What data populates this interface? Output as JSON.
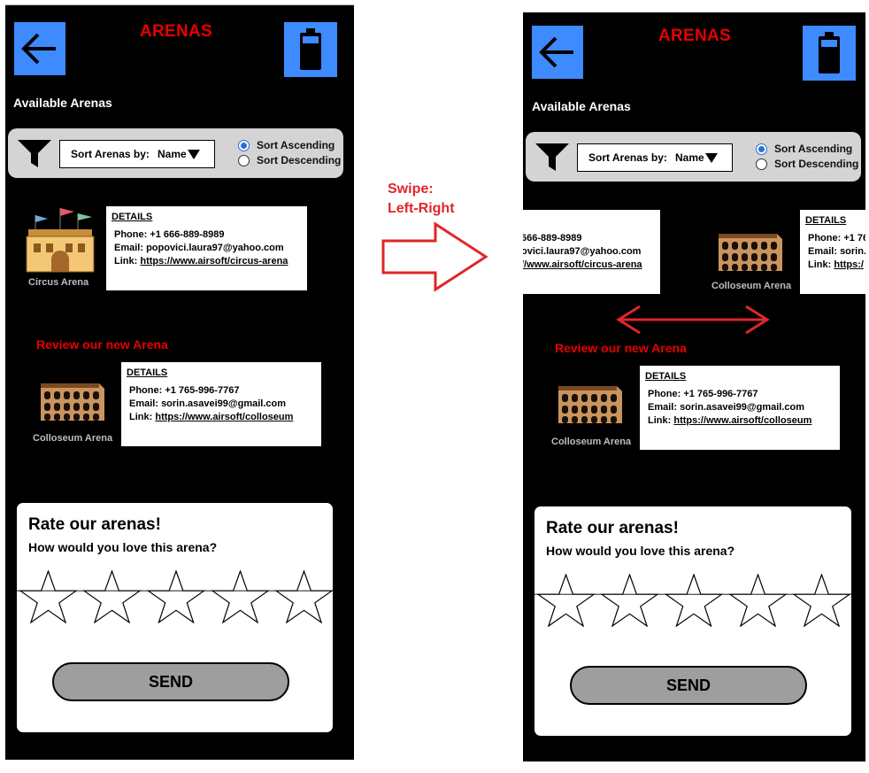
{
  "left_screen": {
    "header": {
      "title": "ARENAS",
      "back_icon": "arrow-left-icon",
      "battery_icon": "battery-icon"
    },
    "section_title": "Available Arenas",
    "filter": {
      "icon": "funnel-icon",
      "sort_label": "Sort Arenas by:",
      "sort_value": "Name",
      "option_ascending": "Sort Ascending",
      "option_descending": "Sort Descending",
      "selected": "ascending"
    },
    "arenas": [
      {
        "caption": "Circus Arena",
        "details_heading": "DETAILS",
        "phone": "Phone: +1 666-889-8989",
        "email": "Email: popovici.laura97@yahoo.com",
        "link_label": "Link: ",
        "link": "https://www.airsoft/circus-arena"
      },
      {
        "caption": "Colloseum Arena",
        "details_heading": "DETAILS",
        "phone": "Phone: +1 765-996-7767",
        "email": "Email: sorin.asavei99@gmail.com",
        "link_label": "Link: ",
        "link": "https://www.airsoft/colloseum"
      }
    ],
    "review_text": "Review our new Arena",
    "rating": {
      "title": "Rate our arenas!",
      "question": "How would you love this arena?",
      "stars": 5,
      "value": 0,
      "send_label": "SEND"
    }
  },
  "annotation": {
    "line1": "Swipe:",
    "line2": "Left-Right",
    "color": "#e0262a"
  },
  "right_screen": {
    "header": {
      "title": "ARENAS"
    },
    "section_title": "Available Arenas",
    "filter": {
      "sort_label": "Sort Arenas by:",
      "sort_value": "Name",
      "option_ascending": "Sort Ascending",
      "option_descending": "Sort Descending"
    },
    "swiped_card_partial": {
      "phone": "666-889-8989",
      "email": "ovici.laura97@yahoo.com",
      "link": "//www.airsoft/circus-arena"
    },
    "incoming_card": {
      "caption": "Colloseum Arena",
      "details_heading": "DETAILS",
      "phone": "Phone: +1 76",
      "email": "Email: sorin.",
      "link_label": "Link: ",
      "link": "https:/"
    },
    "review_text": "Review our new Arena",
    "arena": {
      "caption": "Colloseum Arena",
      "details_heading": "DETAILS",
      "phone": "Phone: +1 765-996-7767",
      "email": "Email: sorin.asavei99@gmail.com",
      "link_label": "Link: ",
      "link": "https://www.airsoft/colloseum"
    },
    "rating": {
      "title": "Rate our arenas!",
      "question": "How would you love this arena?",
      "send_label": "SEND"
    }
  },
  "colors": {
    "accent_blue": "#3d8bff",
    "title_red": "#e60000",
    "screen_bg": "#000000"
  }
}
